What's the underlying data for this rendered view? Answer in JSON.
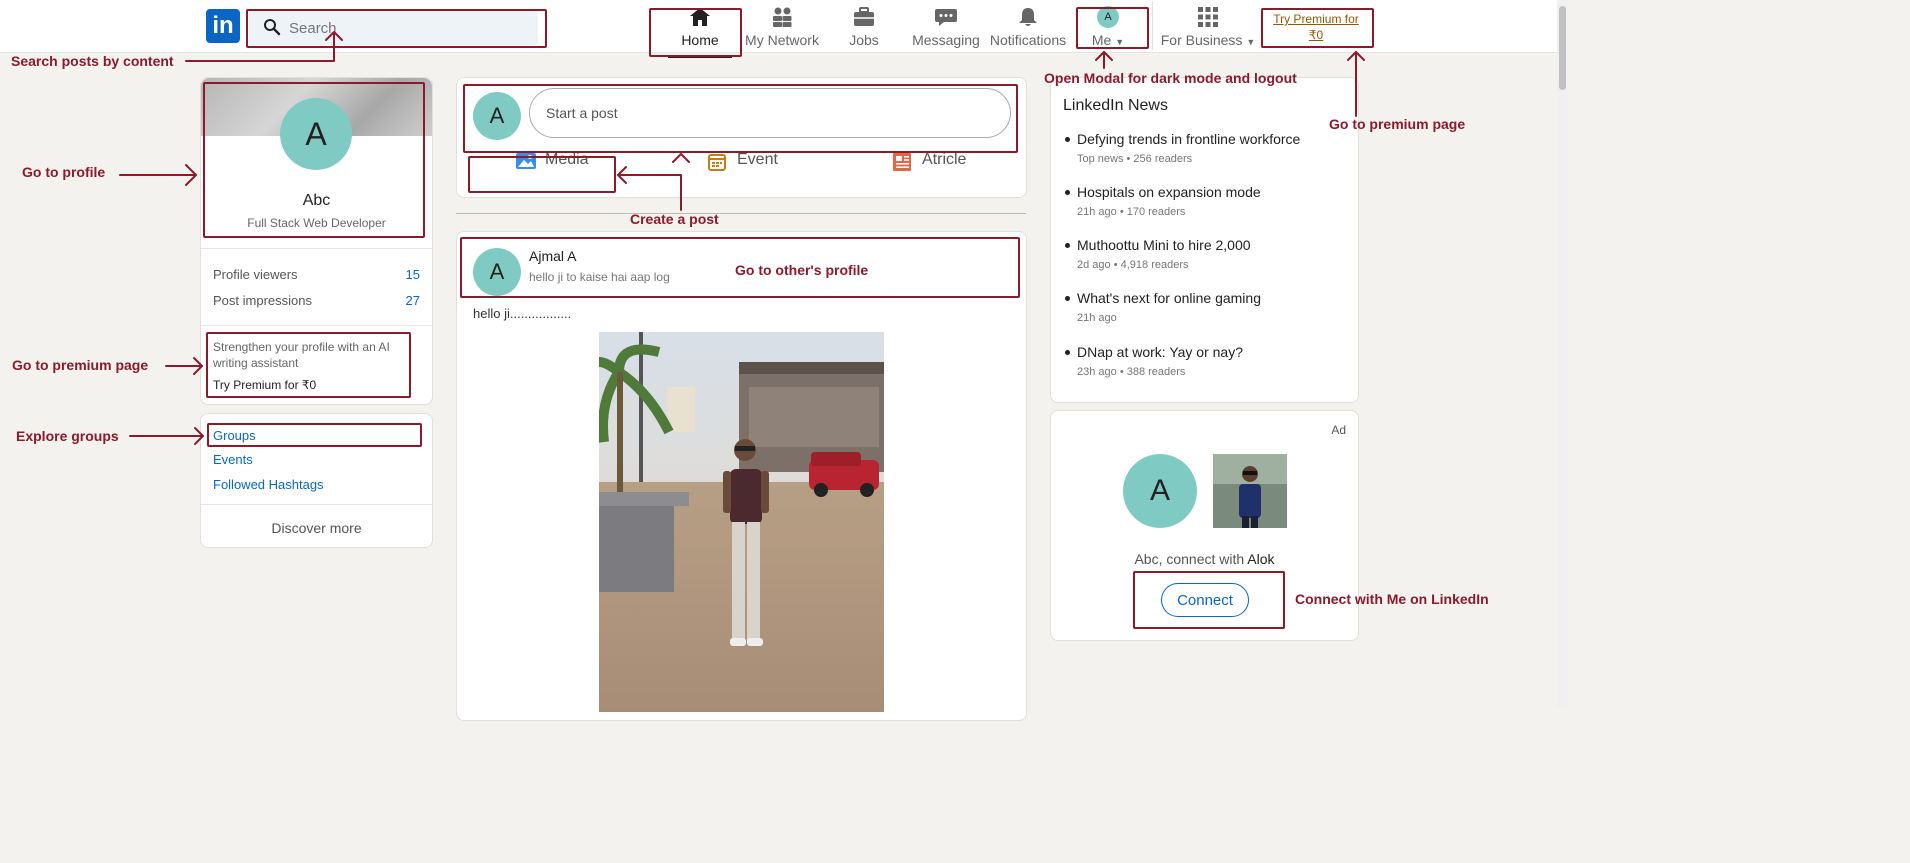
{
  "nav": {
    "logo_text": "in",
    "search_placeholder": "Search",
    "items": [
      {
        "label": "Home",
        "icon": "home-icon"
      },
      {
        "label": "My Network",
        "icon": "network-icon"
      },
      {
        "label": "Jobs",
        "icon": "briefcase-icon"
      },
      {
        "label": "Messaging",
        "icon": "messaging-icon"
      },
      {
        "label": "Notifications",
        "icon": "bell-icon"
      },
      {
        "label": "Me",
        "icon": "avatar"
      },
      {
        "label": "For Business",
        "icon": "grid-icon"
      }
    ],
    "me_avatar_letter": "A",
    "premium_link": "Try Premium for ₹0"
  },
  "profile_card": {
    "avatar_letter": "A",
    "name": "Abc",
    "headline": "Full Stack Web Developer",
    "stats": [
      {
        "label": "Profile viewers",
        "value": "15"
      },
      {
        "label": "Post impressions",
        "value": "27"
      }
    ],
    "premium_text": "Strengthen your profile with an AI writing assistant",
    "premium_cta": "Try Premium for ₹0",
    "links": [
      "Groups",
      "Events",
      "Followed Hashtags"
    ],
    "discover": "Discover more"
  },
  "composer": {
    "avatar_letter": "A",
    "placeholder": "Start a post",
    "actions": [
      {
        "label": "Media",
        "icon": "image-icon",
        "color": "#378fe9"
      },
      {
        "label": "Event",
        "icon": "calendar-icon",
        "color": "#c37d16"
      },
      {
        "label": "Atricle",
        "icon": "article-icon",
        "color": "#e06847"
      }
    ]
  },
  "post": {
    "avatar_letter": "A",
    "author": "Ajmal A",
    "subtitle": "hello ji to kaise hai aap log",
    "text": "hello ji.................",
    "image": "photo of a man standing on a paved sidewalk near palm trees and parked cars"
  },
  "news": {
    "title": "LinkedIn News",
    "items": [
      {
        "headline": "Defying trends in frontline workforce",
        "meta": "Top news • 256 readers"
      },
      {
        "headline": "Hospitals on expansion mode",
        "meta": "21h ago • 170 readers"
      },
      {
        "headline": "Muthoottu Mini to hire 2,000",
        "meta": "2d ago • 4,918 readers"
      },
      {
        "headline": "What's next for online gaming",
        "meta": "21h ago"
      },
      {
        "headline": "DNap at work: Yay or nay?",
        "meta": "23h ago • 388 readers"
      }
    ]
  },
  "ad": {
    "label": "Ad",
    "avatar_letter": "A",
    "text_prefix": "Abc, connect with ",
    "connect_name": "Alok",
    "button": "Connect"
  },
  "annotations": {
    "search": "Search posts by content",
    "profile": "Go to profile",
    "premium_left": "Go to premium page",
    "groups": "Explore groups",
    "create_post": "Create a post",
    "other_profile": "Go to other's profile",
    "me_modal": "Open Modal for dark mode and logout",
    "premium_right": "Go to premium page",
    "connect": "Connect with Me on LinkedIn"
  },
  "colors": {
    "brand": "#0a66c2",
    "annotation": "#8b1a2b",
    "avatar": "#7fcbc4"
  }
}
